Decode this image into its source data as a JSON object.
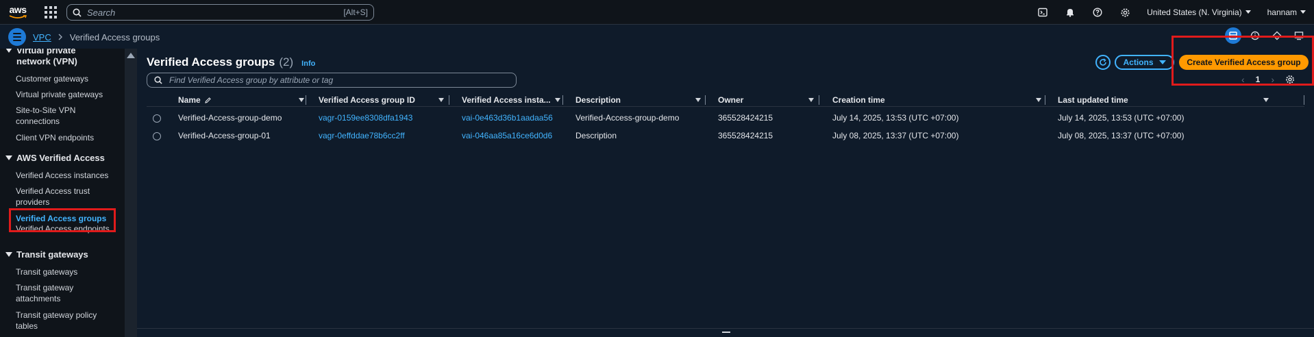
{
  "topnav": {
    "logo_text": "aws",
    "search_placeholder": "Search",
    "search_shortcut": "[Alt+S]",
    "region": "United States (N. Virginia)",
    "user": "hannam",
    "icons": [
      "cloudshell-icon",
      "bell-icon",
      "help-icon",
      "settings-icon"
    ]
  },
  "breadcrumb": {
    "parent": "VPC",
    "current": "Verified Access groups"
  },
  "sidebar": {
    "sections": [
      {
        "title": "Virtual private network (VPN)",
        "items": [
          "Customer gateways",
          "Virtual private gateways",
          "Site-to-Site VPN connections",
          "Client VPN endpoints"
        ]
      },
      {
        "title": "AWS Verified Access",
        "items": [
          "Verified Access instances",
          "Verified Access trust providers",
          "Verified Access groups",
          "Verified Access endpoints"
        ]
      },
      {
        "title": "Transit gateways",
        "items": [
          "Transit gateways",
          "Transit gateway attachments",
          "Transit gateway policy tables"
        ]
      }
    ],
    "active_item": "Verified Access groups"
  },
  "main": {
    "title": "Verified Access groups",
    "count": "(2)",
    "info": "Info",
    "actions_label": "Actions",
    "create_label": "Create Verified Access group",
    "filter_placeholder": "Find Verified Access group by attribute or tag",
    "page": "1"
  },
  "table": {
    "columns": [
      "Name",
      "Verified Access group ID",
      "Verified Access insta...",
      "Description",
      "Owner",
      "Creation time",
      "Last updated time"
    ],
    "rows": [
      [
        "Verified-Access-group-demo",
        "vagr-0159ee8308dfa1943",
        "vai-0e463d36b1aadaa56",
        "Verified-Access-group-demo",
        "365528424215",
        "July 14, 2025, 13:53 (UTC +07:00)",
        "July 14, 2025, 13:53 (UTC +07:00)"
      ],
      [
        "Verified-Access-group-01",
        "vagr-0effddae78b6cc2ff",
        "vai-046aa85a16ce6d0d6",
        "Description",
        "365528424215",
        "July 08, 2025, 13:37 (UTC +07:00)",
        "July 08, 2025, 13:37 (UTC +07:00)"
      ]
    ]
  },
  "colors": {
    "accent": "#42b4ff",
    "primary_button": "#ff9900",
    "highlight_box": "#e01b1b"
  }
}
